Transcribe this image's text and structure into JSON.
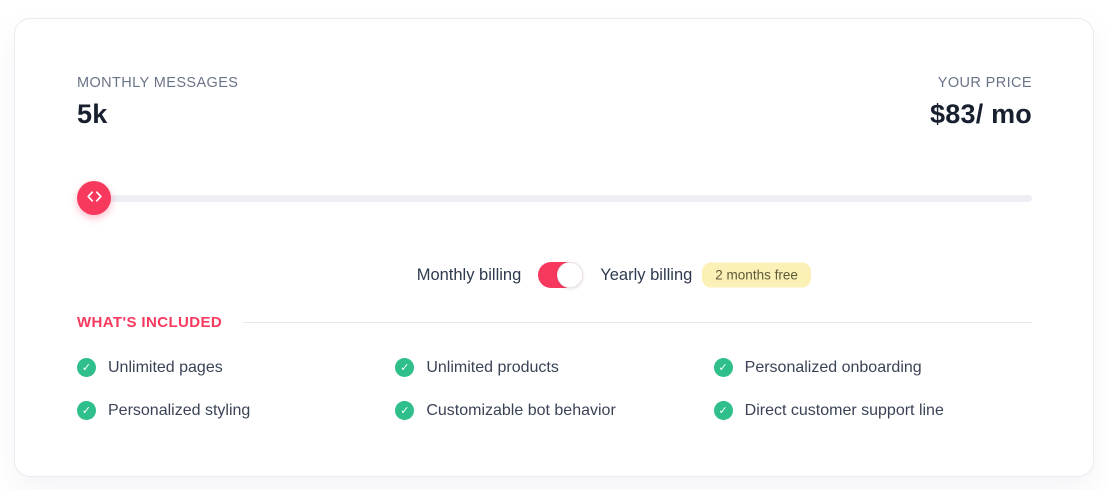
{
  "card": {
    "messages": {
      "label": "MONTHLY MESSAGES",
      "value": "5k"
    },
    "price": {
      "label": "YOUR PRICE",
      "value": "$83/ mo"
    },
    "billing": {
      "monthly_label": "Monthly billing",
      "yearly_label": "Yearly billing",
      "badge_label": "2 months free",
      "toggle_knob_position": "right"
    },
    "included": {
      "heading": "WHAT'S INCLUDED",
      "features": [
        "Unlimited pages",
        "Unlimited products",
        "Personalized onboarding",
        "Personalized styling",
        "Customizable bot behavior",
        "Direct customer support line"
      ]
    }
  },
  "icons": {
    "check_glyph": "✓",
    "slider_handle": "chevron-left-right",
    "feature_check": "checkmark-circle"
  },
  "colors": {
    "accent_rose": "#f8395e",
    "check_green": "#2fbf8a",
    "badge_bg": "#fbf0b6",
    "badge_text": "#5f5a38",
    "slider_track": "#edeff4",
    "value_dark": "#18202f",
    "label_gray": "#6a7488"
  }
}
